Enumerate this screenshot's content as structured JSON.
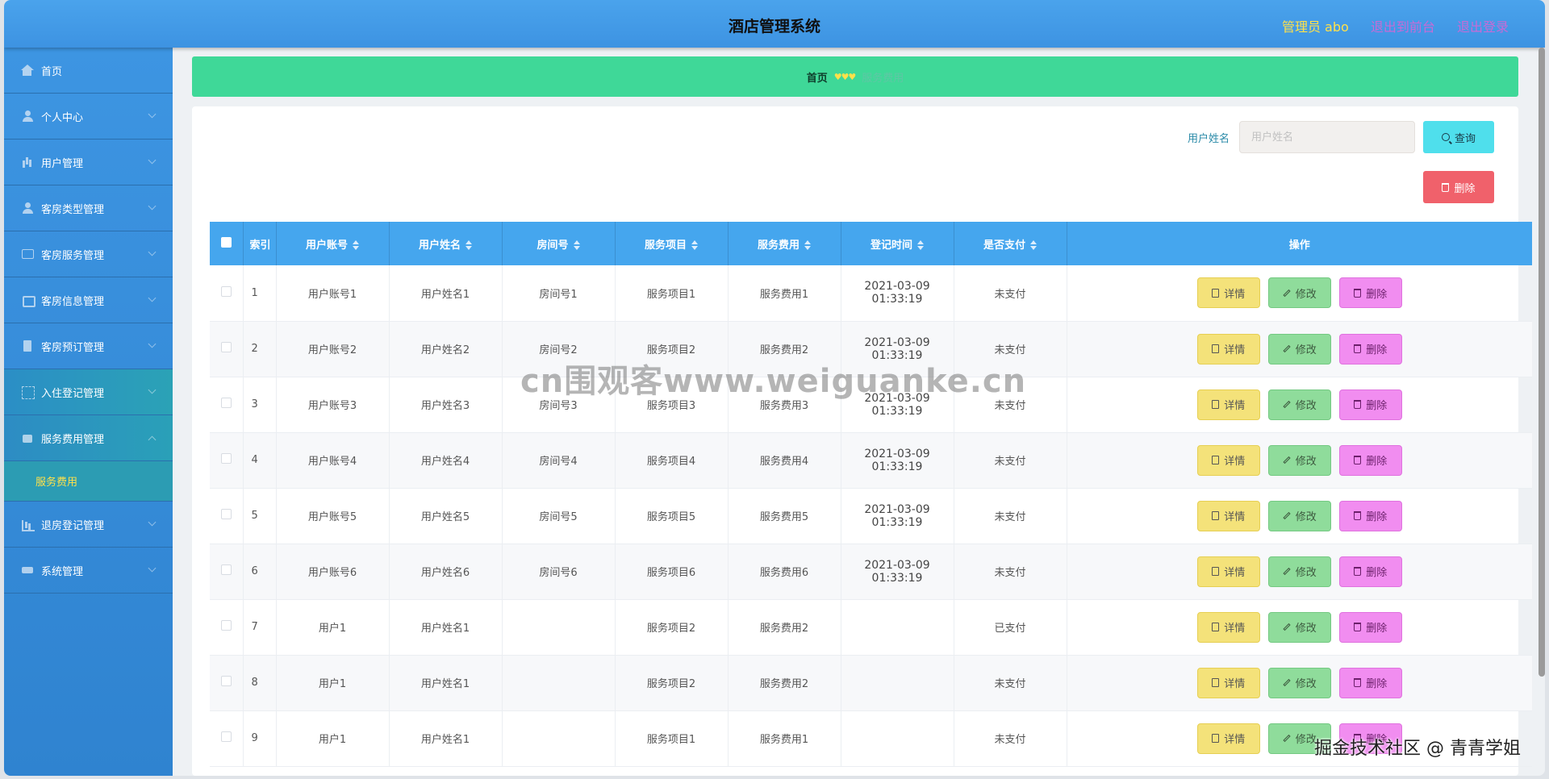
{
  "header": {
    "title": "酒店管理系统",
    "admin_label": "管理员 abo",
    "back_label": "退出到前台",
    "logout_label": "退出登录"
  },
  "sidebar": {
    "items": [
      {
        "label": "首页",
        "icon": "home-icon"
      },
      {
        "label": "个人中心",
        "icon": "user-icon"
      },
      {
        "label": "用户管理",
        "icon": "bar-chart-icon"
      },
      {
        "label": "客房类型管理",
        "icon": "user-icon"
      },
      {
        "label": "客房服务管理",
        "icon": "chat-icon"
      },
      {
        "label": "客房信息管理",
        "icon": "box-icon"
      },
      {
        "label": "客房预订管理",
        "icon": "bill-icon"
      },
      {
        "label": "入住登记管理",
        "icon": "scan-icon"
      },
      {
        "label": "服务费用管理",
        "icon": "bag-icon"
      },
      {
        "label": "退房登记管理",
        "icon": "chart-icon"
      },
      {
        "label": "系统管理",
        "icon": "gear-icon"
      }
    ],
    "submenu_label": "服务费用"
  },
  "breadcrumb": {
    "home": "首页",
    "separator": "♥♥♥",
    "current": "服务费用"
  },
  "search": {
    "label": "用户姓名",
    "placeholder": "用户姓名",
    "button_label": "查询"
  },
  "toolbar": {
    "delete_label": "删除"
  },
  "table": {
    "headers": [
      "索引",
      "用户账号",
      "用户姓名",
      "房间号",
      "服务项目",
      "服务费用",
      "登记时间",
      "是否支付",
      "操作"
    ],
    "ops": {
      "detail": "详情",
      "edit": "修改",
      "delete": "删除"
    },
    "rows": [
      {
        "idx": "1",
        "account": "用户账号1",
        "name": "用户姓名1",
        "room": "房间号1",
        "service": "服务项目1",
        "fee": "服务费用1",
        "time": "2021-03-09 01:33:19",
        "paid": "未支付"
      },
      {
        "idx": "2",
        "account": "用户账号2",
        "name": "用户姓名2",
        "room": "房间号2",
        "service": "服务项目2",
        "fee": "服务费用2",
        "time": "2021-03-09 01:33:19",
        "paid": "未支付"
      },
      {
        "idx": "3",
        "account": "用户账号3",
        "name": "用户姓名3",
        "room": "房间号3",
        "service": "服务项目3",
        "fee": "服务费用3",
        "time": "2021-03-09 01:33:19",
        "paid": "未支付"
      },
      {
        "idx": "4",
        "account": "用户账号4",
        "name": "用户姓名4",
        "room": "房间号4",
        "service": "服务项目4",
        "fee": "服务费用4",
        "time": "2021-03-09 01:33:19",
        "paid": "未支付"
      },
      {
        "idx": "5",
        "account": "用户账号5",
        "name": "用户姓名5",
        "room": "房间号5",
        "service": "服务项目5",
        "fee": "服务费用5",
        "time": "2021-03-09 01:33:19",
        "paid": "未支付"
      },
      {
        "idx": "6",
        "account": "用户账号6",
        "name": "用户姓名6",
        "room": "房间号6",
        "service": "服务项目6",
        "fee": "服务费用6",
        "time": "2021-03-09 01:33:19",
        "paid": "未支付"
      },
      {
        "idx": "7",
        "account": "用户1",
        "name": "用户姓名1",
        "room": "",
        "service": "服务项目2",
        "fee": "服务费用2",
        "time": "",
        "paid": "已支付"
      },
      {
        "idx": "8",
        "account": "用户1",
        "name": "用户姓名1",
        "room": "",
        "service": "服务项目2",
        "fee": "服务费用2",
        "time": "",
        "paid": "未支付"
      },
      {
        "idx": "9",
        "account": "用户1",
        "name": "用户姓名1",
        "room": "",
        "service": "服务项目1",
        "fee": "服务费用1",
        "time": "",
        "paid": "未支付"
      }
    ]
  },
  "watermarks": {
    "center": "cn围观客www.weiguanke.cn",
    "corner": "掘金技术社区 @ 青青学姐"
  },
  "colors": {
    "header": "#4aa3ec",
    "sidebar": "#3d95e2",
    "breadcrumb": "#3fd898",
    "table_header": "#45a6ee",
    "search_button": "#4fdfec",
    "delete_button": "#f0616b",
    "detail_button": "#f4e27a",
    "edit_button": "#8fdc9b",
    "row_delete_button": "#f18df0"
  }
}
